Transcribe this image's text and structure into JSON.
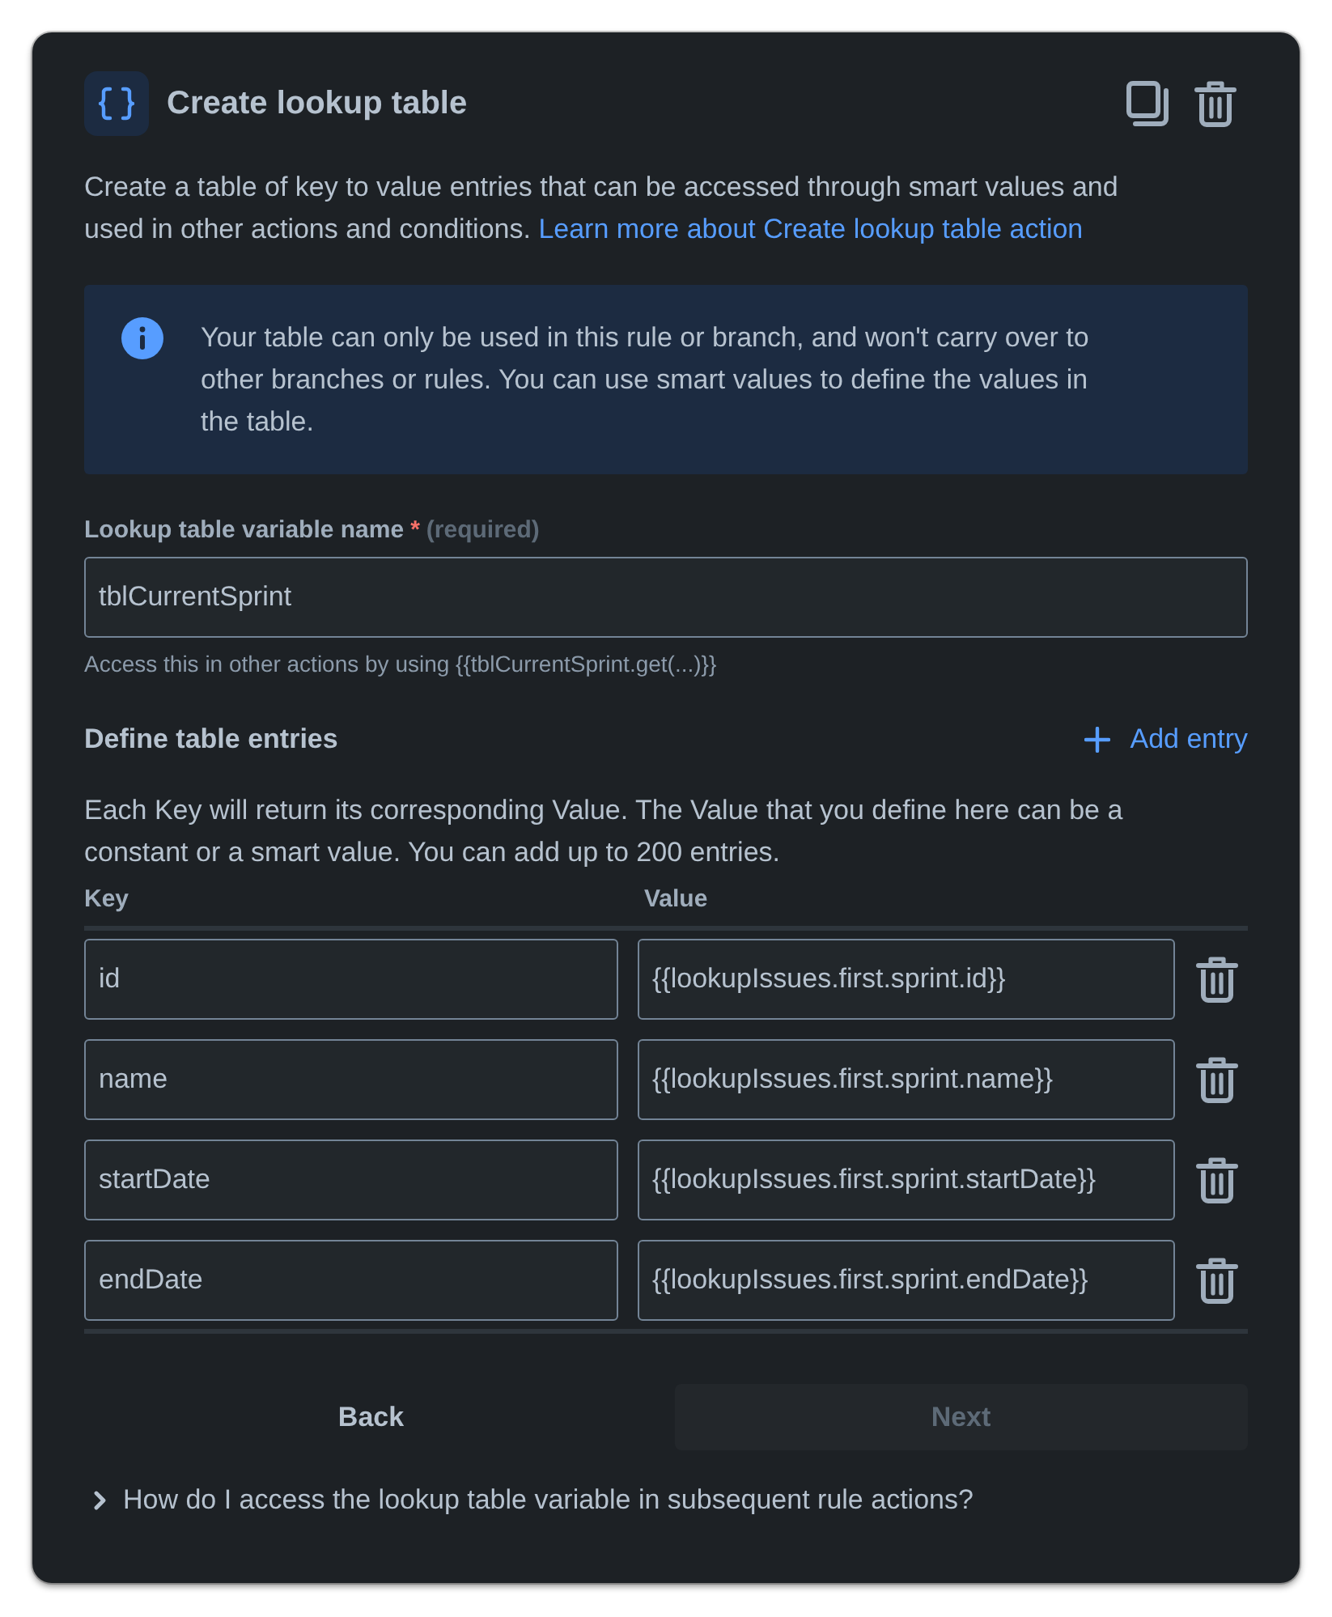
{
  "header": {
    "title": "Create lookup table"
  },
  "description": {
    "text": "Create a table of key to value entries that can be accessed through smart values and used in other actions and conditions.",
    "link": "Learn more about Create lookup table action"
  },
  "info_panel": {
    "text": "Your table can only be used in this rule or branch, and won't carry over to other branches or rules. You can use smart values to define the values in the table."
  },
  "variable_field": {
    "label": "Lookup table variable name",
    "required_mark": "*",
    "required_note": "(required)",
    "value": "tblCurrentSprint",
    "helper": "Access this in other actions by using {{tblCurrentSprint.get(...)}}"
  },
  "entries": {
    "title": "Define table entries",
    "add_button": "Add entry",
    "description": "Each Key will return its corresponding Value. The Value that you define here can be a constant or a smart value. You can add up to 200 entries.",
    "columns": [
      "Key",
      "Value"
    ],
    "rows": [
      {
        "key": "id",
        "value": "{{lookupIssues.first.sprint.id}}"
      },
      {
        "key": "name",
        "value": "{{lookupIssues.first.sprint.name}}"
      },
      {
        "key": "startDate",
        "value": "{{lookupIssues.first.sprint.startDate}}"
      },
      {
        "key": "endDate",
        "value": "{{lookupIssues.first.sprint.endDate}}"
      }
    ]
  },
  "footer": {
    "buttons": [
      {
        "label": "Back",
        "kind": "subtle",
        "disabled": false
      },
      {
        "label": "Next",
        "kind": "primary",
        "disabled": true
      }
    ]
  },
  "faq": {
    "text": "How do I access the lookup table variable in subsequent rule actions?",
    "expanded": false
  }
}
